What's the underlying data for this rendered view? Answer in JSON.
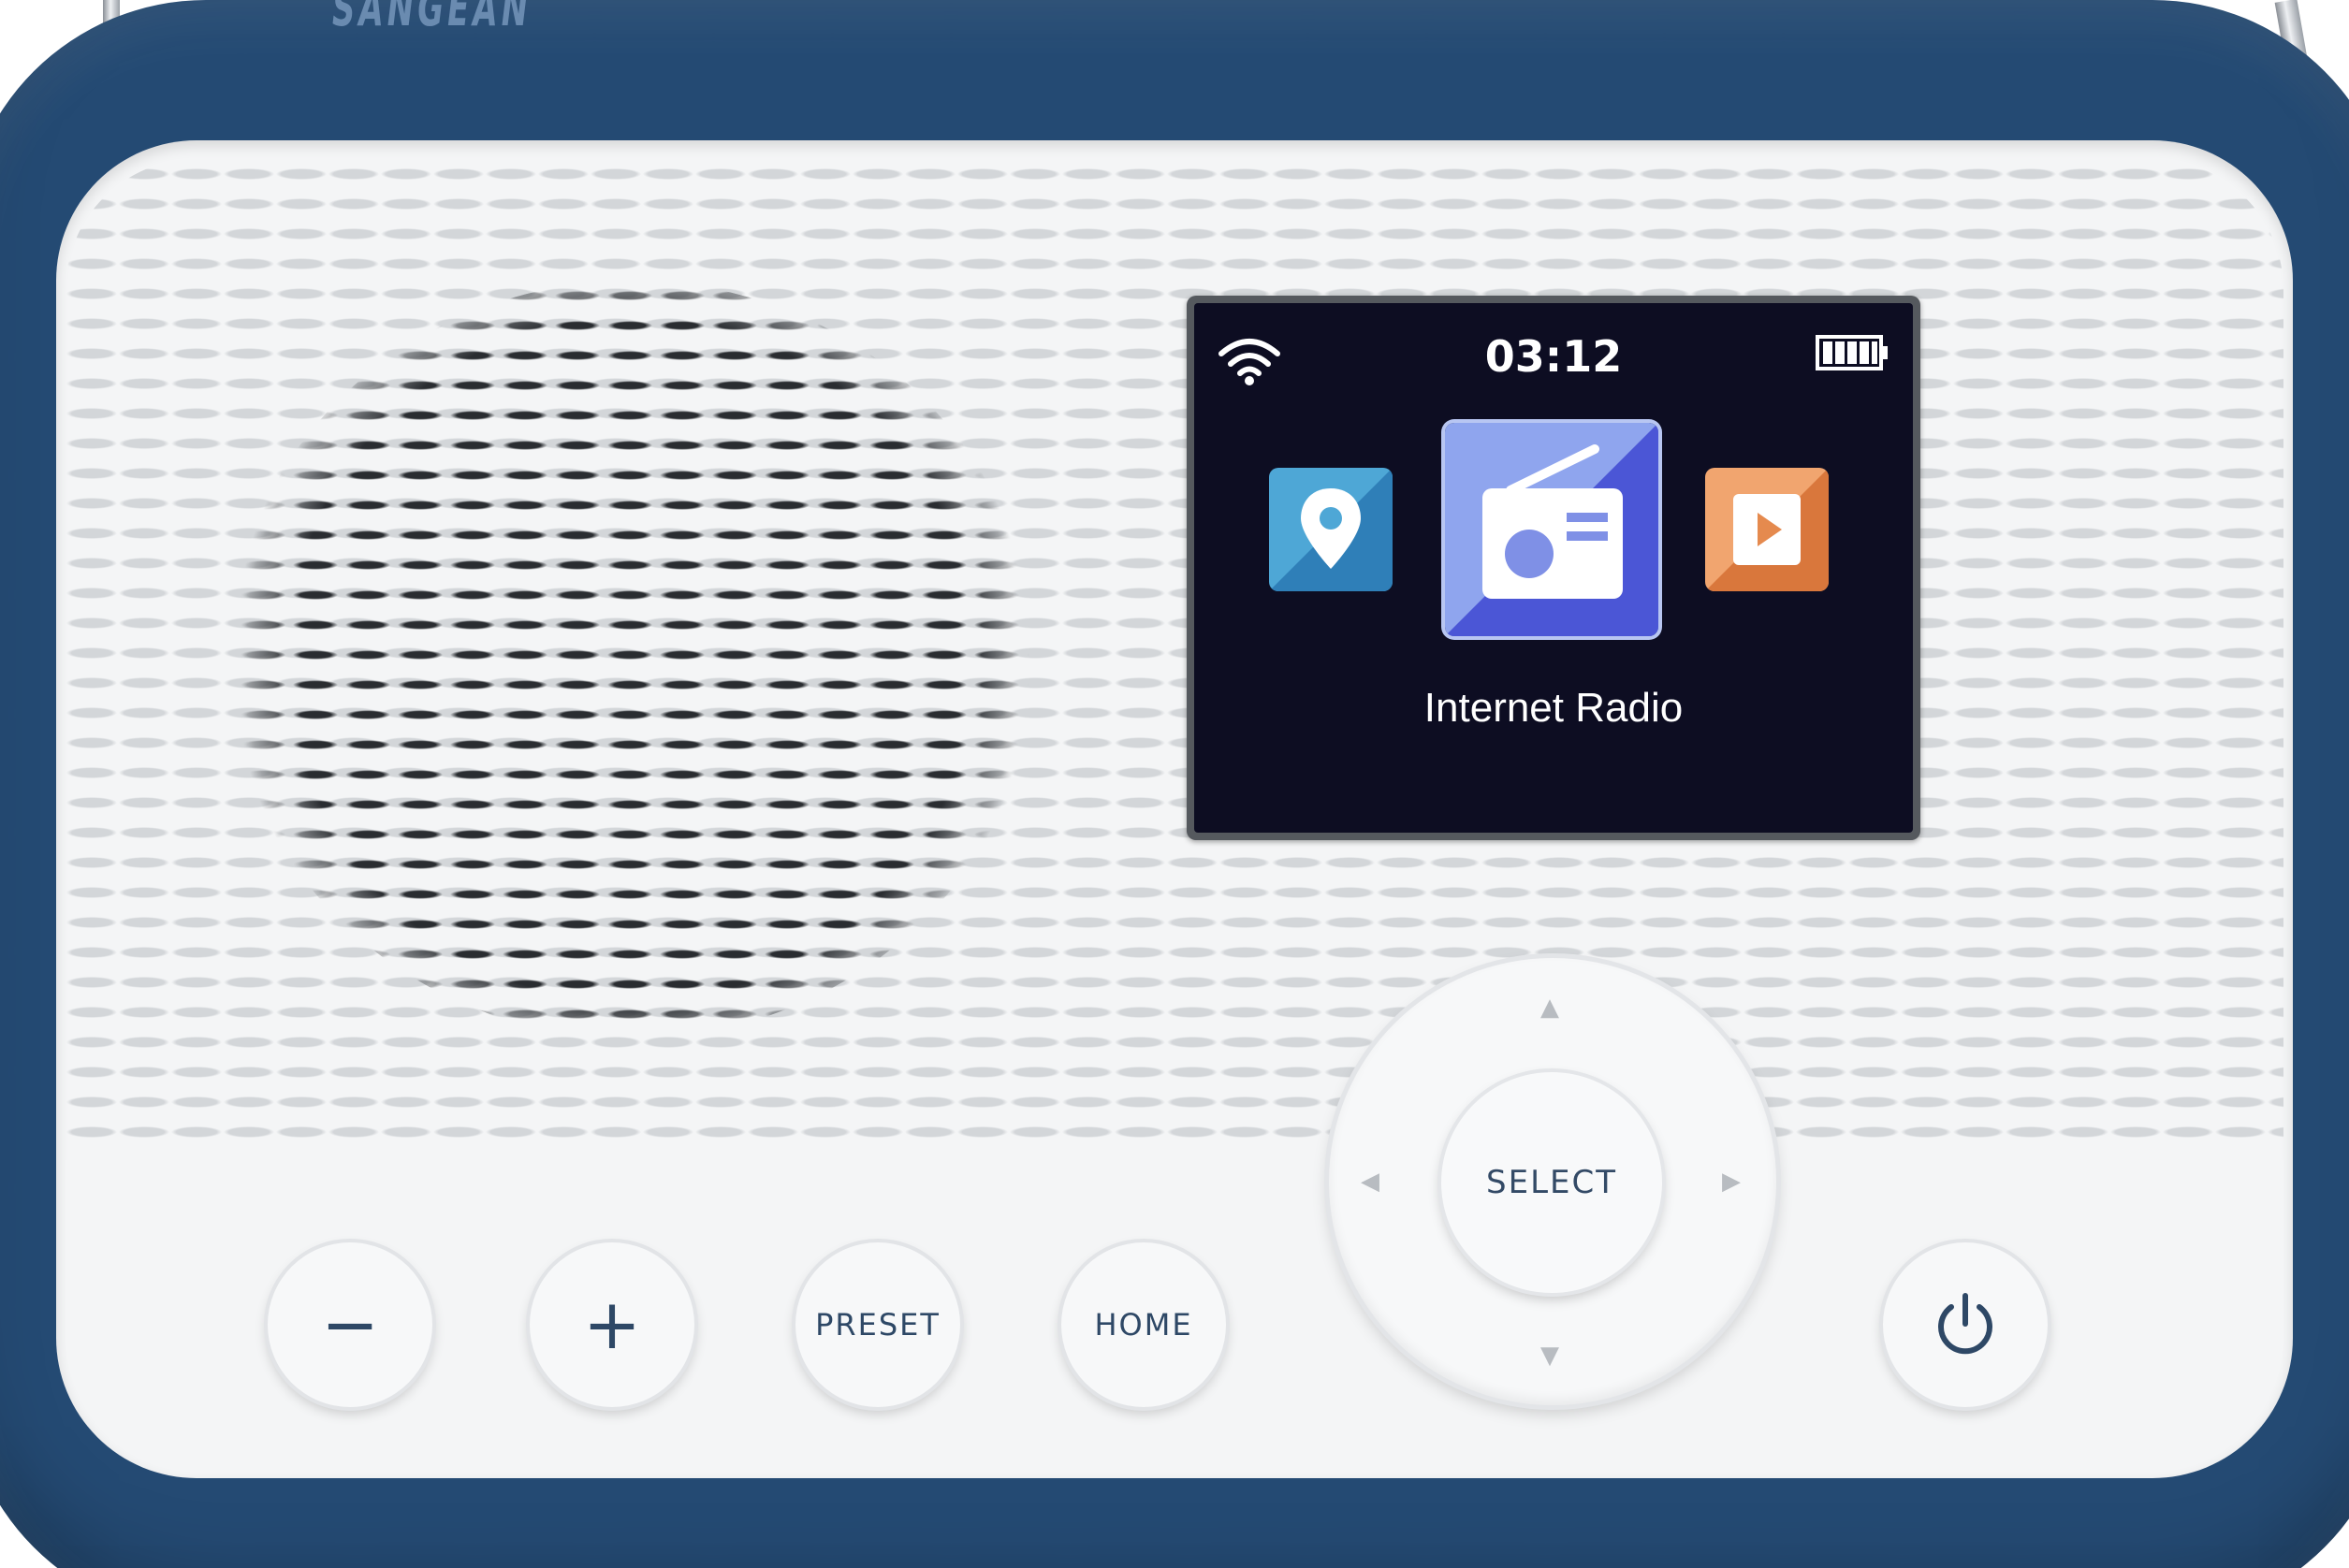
{
  "device": {
    "brand": "SANGEAN",
    "body_color": "#244a73",
    "face_color": "#f4f5f6"
  },
  "screen": {
    "time": "03:12",
    "wifi_icon": "wifi-icon",
    "battery_icon": "battery-icon",
    "menu_items": [
      {
        "icon": "location-icon",
        "color": "#4aa6d8"
      },
      {
        "icon": "radio-icon",
        "color": "#5a6ee0",
        "selected": true
      },
      {
        "icon": "media-play-icon",
        "color": "#e58a4e"
      }
    ],
    "selected_label": "Internet Radio"
  },
  "controls": {
    "select_label": "SELECT",
    "buttons": [
      {
        "label": "−",
        "icon": "minus-icon"
      },
      {
        "label": "+",
        "icon": "plus-icon"
      },
      {
        "label": "PRESET"
      },
      {
        "label": "HOME"
      },
      {
        "icon": "power-icon"
      }
    ],
    "dpad_arrows": [
      "up-arrow-icon",
      "down-arrow-icon",
      "left-arrow-icon",
      "right-arrow-icon"
    ]
  }
}
